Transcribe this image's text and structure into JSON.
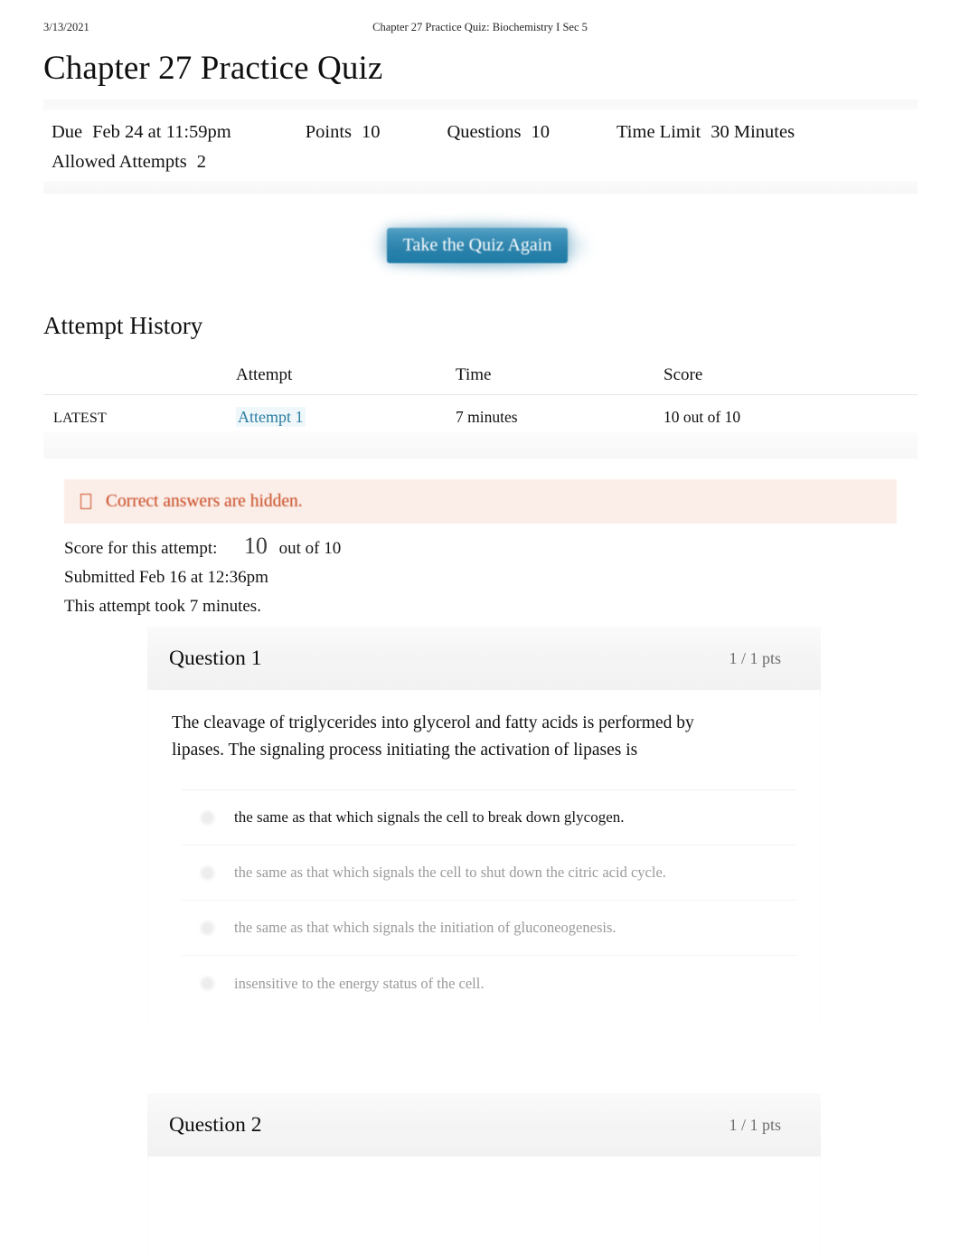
{
  "print_header": {
    "date": "3/13/2021",
    "document_title": "Chapter 27 Practice Quiz: Biochemistry I Sec 5"
  },
  "page_title": "Chapter 27 Practice Quiz",
  "quiz_meta": {
    "due_label": "Due",
    "due_value": "Feb 24 at 11:59pm",
    "points_label": "Points",
    "points_value": "10",
    "questions_label": "Questions",
    "questions_value": "10",
    "time_limit_label": "Time Limit",
    "time_limit_value": "30 Minutes",
    "allowed_attempts_label": "Allowed Attempts",
    "allowed_attempts_value": "2"
  },
  "actions": {
    "take_quiz_again": "Take the Quiz Again"
  },
  "attempt_history": {
    "heading": "Attempt History",
    "columns": [
      "",
      "Attempt",
      "Time",
      "Score"
    ],
    "rows": [
      {
        "kept": "LATEST",
        "attempt": "Attempt 1",
        "time": "7 minutes",
        "score": "10 out of 10"
      }
    ]
  },
  "alert": {
    "icon": "warning-box-icon",
    "message": "Correct answers are hidden.",
    "background": "#fbeee9",
    "text_color": "#c8441a"
  },
  "score_summary": {
    "score_label": "Score for this attempt:",
    "score_value": "10",
    "score_out_of": "out of 10",
    "submitted": "Submitted Feb 16 at 12:36pm",
    "duration": "This attempt took 7 minutes."
  },
  "questions": [
    {
      "name": "Question 1",
      "points": "1 / 1 pts",
      "text": "The cleavage of triglycerides into glycerol and fatty acids is performed by lipases. The signaling process initiating the activation of lipases is",
      "answers": [
        {
          "text": "the same as that which signals the cell to break down glycogen.",
          "selected": true
        },
        {
          "text": "the same as that which signals the cell to shut down the citric acid cycle.",
          "selected": false
        },
        {
          "text": "the same as that which signals the initiation of gluconeogenesis.",
          "selected": false
        },
        {
          "text": "insensitive to the energy status of the cell.",
          "selected": false
        }
      ]
    },
    {
      "name": "Question 2",
      "points": "1 / 1 pts",
      "text": "",
      "answers": []
    }
  ],
  "colors": {
    "link": "#2a7da1",
    "button_blue": "#2b82ab",
    "alert_text": "#c8441a",
    "alert_bg": "#fbeee9",
    "question_header_bg": "#f4f4f4"
  }
}
